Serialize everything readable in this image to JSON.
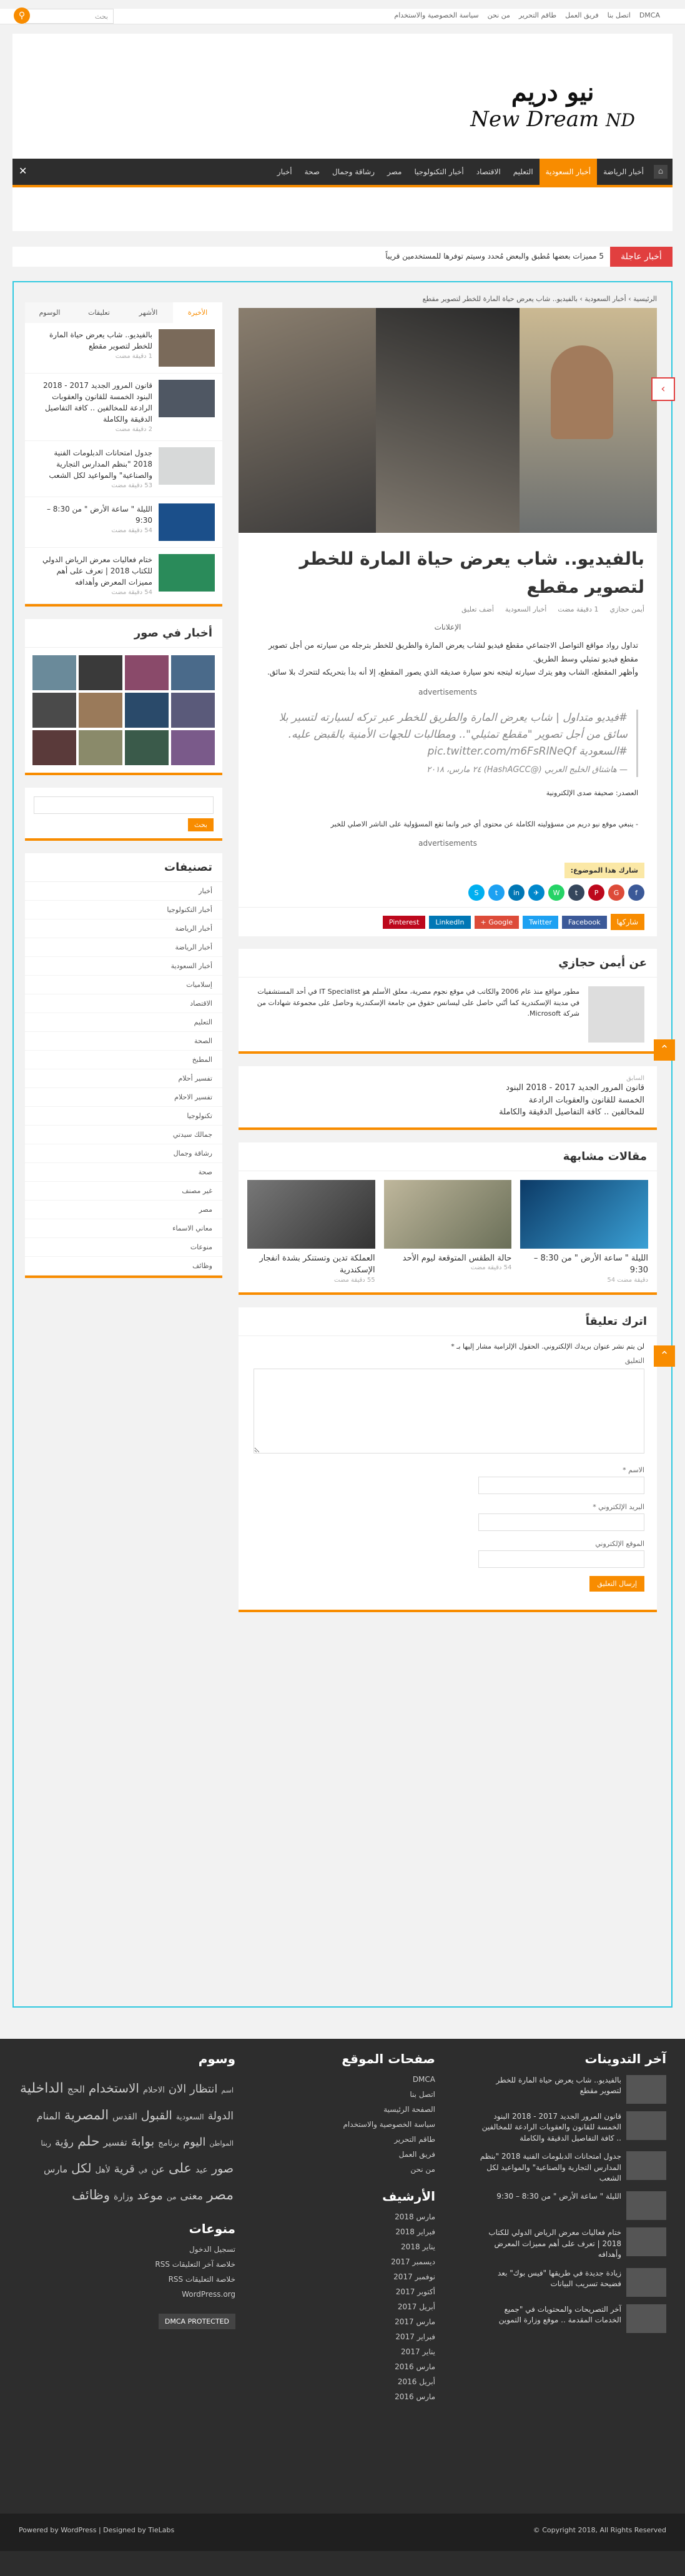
{
  "topbar": {
    "links": [
      "DMCA",
      "اتصل بنا",
      "فريق العمل",
      "طاقم التحرير",
      "من نحن",
      "سياسة الخصوصية والاستخدام"
    ],
    "search_placeholder": "بحث"
  },
  "logo": {
    "arabic": "نيو دريم",
    "english": "New Dream",
    "mark": "ND"
  },
  "nav": {
    "items": [
      "أخبار الرياضة",
      "أخبار السعودية",
      "التعليم",
      "الاقتصاد",
      "أخبار التكنولوجيا",
      "مصر",
      "رشاقة وجمال",
      "صحة",
      "أخبار"
    ]
  },
  "breaking": {
    "label": "أخبار عاجلة",
    "text": "5 مميزات بعضها مُطبق والبعض مُحدد وسيتم توفرها للمستخدمين قريباً"
  },
  "breadcrumb": [
    "الرئيسية",
    "أخبار السعودية",
    "بالفيديو.. شاب يعرض حياة المارة للخطر لتصوير مقطع"
  ],
  "post": {
    "title": "بالفيديو.. شاب يعرض حياة المارة للخطر لتصوير مقطع",
    "meta": {
      "author": "أيمن حجازي",
      "time": "1 دقيقة مضت",
      "category": "أخبار السعودية",
      "comments": "أضف تعليق"
    },
    "ad_label": "الإعلانات",
    "body": "تداول رواد مواقع التواصل الاجتماعي مقطع فيديو لشاب يعرض المارة والطريق للخطر بترجله من سيارته من أجل تصوير مقطع فيديو تمثيلي وسط الطريق.",
    "body2": "وأظهر المقطع، الشاب وهو يترك سيارته ليتجه نحو سيارة صديقه الذي يصور المقطع، إلا أنه بدأ بتحريكه لتتحرك بلا سائق.",
    "tweet": "#فيديو متداول | شاب يعرض المارة والطريق للخطر عبر تركه لسيارته لتسير بلا سائق من أجل تصوير \"مقطع تمثيلي\".. ومطالبات للجهات الأمنية بالقبض عليه. #السعودية pic.twitter.com/m6FsRlNeQf",
    "tweet_author": "— هاشتاق الخليج العربي (@HashAGCC) ٢٤ مارس، ٢٠١٨",
    "source": "العصدر: صحيفة صدى الإلكترونية",
    "disclaimer": "- ينبغي موقع نيو دريم من مسؤوليته الكاملة عن محتوى أي خبر وانما تقع المسؤولية على الناشر الاصلي للخبر",
    "advertisements": "advertisements",
    "share_label": "شارك هذا الموضوع:",
    "share_buttons": [
      "Facebook",
      "Twitter",
      "Google +",
      "LinkedIn",
      "Pinterest"
    ],
    "share_title": "شاركها"
  },
  "author_box": {
    "title": "عن أيمن حجازي",
    "bio": "مطور مواقع منذ عام 2006 والكاتب في موقع نجوم مصرية، معلق الأسلم هو IT Specialist في أحد المستشفيات في مدينة الإسكندرية كما أنّني حاصل على ليسانس حقوق من جامعة الإسكندرية وحاصل على مجموعة شهادات من شركة Microsoft."
  },
  "prev_post": {
    "label": "السابق",
    "title": "قانون المرور الجديد 2017 - 2018 البنود الخمسة للقانون والعقوبات الرادعة للمخالفين .. كافة التفاصيل الدقيقة والكاملة"
  },
  "related": {
    "title": "مقالات مشابهة",
    "items": [
      {
        "title": "الليلة \" ساعة الأرض \" من 8:30 – 9:30",
        "time": "دقيقة مضت 54"
      },
      {
        "title": "حالة الطقس المتوقعة ليوم الأحد",
        "time": "54 دقيقة مضت"
      },
      {
        "title": "العملكة تدين وتستنكر بشدة انفجار الإسكندرية",
        "time": "55 دقيقة مضت"
      }
    ]
  },
  "comment_form": {
    "title": "اترك تعليقاً",
    "note": "لن يتم نشر عنوان بريدك الإلكتروني. الحقول الإلزامية مشار إليها بـ *",
    "label_comment": "التعليق",
    "label_name": "الاسم *",
    "label_email": "البريد الإلكتروني *",
    "label_site": "الموقع الإلكتروني",
    "submit": "إرسال التعليق"
  },
  "sidebar": {
    "tabs": [
      "الأخيرة",
      "الأشهر",
      "تعليقات",
      "الوسوم"
    ],
    "recent": [
      {
        "title": "بالفيديو.. شاب يعرض حياة المارة للخطر لتصوير مقطع",
        "time": "1 دقيقة مضت"
      },
      {
        "title": "قانون المرور الجديد 2017 - 2018 البنود الخمسة للقانون والعقوبات الرادعة للمخالفين .. كافة التفاصيل الدقيقة والكاملة",
        "time": "2 دقيقة مضت"
      },
      {
        "title": "جدول امتحانات الدبلومات الفنية 2018 \"بنظم المدارس التجارية والصناعية\" والمواعيد لكل الشعب",
        "time": "53 دقيقة مضت"
      },
      {
        "title": "الليلة \" ساعة الأرض \" من 8:30 – 9:30",
        "time": "54 دقيقة مضت"
      },
      {
        "title": "ختام فعاليات معرض الرياض الدولي للكتاب 2018 | تعرف على أهم مميزات المعرض وأهدافه",
        "time": "54 دقيقة مضت"
      }
    ],
    "gallery_title": "أخبار في صور",
    "search_placeholder": "",
    "search_button": "بحث",
    "categories_title": "تصنيفات",
    "categories": [
      "أخبار",
      "أخبار التكنولوجيا",
      "أخبار الرياضة",
      "أخبار الرياضة",
      "أخبار السعودية",
      "إسلاميات",
      "الاقتصاد",
      "التعليم",
      "الصحة",
      "المطبخ",
      "تفسير أحلام",
      "تفسير الاحلام",
      "تكنولوجيا",
      "جمالك سيدتي",
      "رشاقة وجمال",
      "صحة",
      "غير مصنف",
      "مصر",
      "معاني الاسماء",
      "منوعات",
      "وظائف"
    ]
  },
  "footer": {
    "latest_title": "آخر التدوينات",
    "latest": [
      "بالفيديو.. شاب يعرض حياة المارة للخطر لتصوير مقطع",
      "قانون المرور الجديد 2017 - 2018 البنود الخمسة للقانون والعقوبات الرادعة للمخالفين .. كافة التفاصيل الدقيقة والكاملة",
      "جدول امتحانات الدبلومات الفنية 2018 \"بنظم المدارس التجارية والصناعية\" والمواعيد لكل الشعب",
      "الليلة \" ساعة الأرض \" من 8:30 – 9:30",
      "ختام فعاليات معرض الرياض الدولي للكتاب 2018 | تعرف على أهم مميزات المعرض وأهدافه",
      "زيادة جديدة في طريقها \"فيس بوك\" بعد فضيحة تسريب البيانات",
      "آخر التصريحات والمحتويات في \"جميع الخدمات المقدمة .. موقع وزارة التموين"
    ],
    "pages_title": "صفحات الموقع",
    "pages": [
      "DMCA",
      "اتصل بنا",
      "الصفحة الرئيسية",
      "سياسة الخصوصية والاستخدام",
      "طاقم التحرير",
      "فريق العمل",
      "من نحن"
    ],
    "archive_title": "الأرشيف",
    "archive": [
      "مارس 2018",
      "فبراير 2018",
      "يناير 2018",
      "ديسمبر 2017",
      "نوفمبر 2017",
      "أكتوبر 2017",
      "أبريل 2017",
      "مارس 2017",
      "فبراير 2017",
      "يناير 2017",
      "مارس 2016",
      "أبريل 2016",
      "مارس 2016"
    ],
    "tags_title": "وسوم",
    "tags": [
      "اسم",
      "انتظار الان",
      "الاحلام",
      "الاستخدام",
      "الحج",
      "الداخلية",
      "الدولة",
      "السعودية",
      "القبول",
      "القدس",
      "المصرية",
      "المنام",
      "المواطن",
      "اليوم",
      "برنامج",
      "بوابة",
      "تفسير",
      "حلم",
      "رؤية",
      "ربنا",
      "صور",
      "عيد",
      "على",
      "عن",
      "في",
      "قرية",
      "لأهل",
      "لكل",
      "مارس",
      "مصر",
      "معنى",
      "من",
      "موعد",
      "وزارة",
      "وظائف"
    ],
    "misc_title": "منوعات",
    "misc": [
      "تسجيل الدخول",
      "خلاصة آخر التعليقات RSS",
      "خلاصة التعليقات RSS",
      "WordPress.org"
    ],
    "copyright": "Copyright 2018, All Rights Reserved ©",
    "powered": "Powered by WordPress | Designed by TieLabs",
    "dmca": "DMCA PROTECTED"
  },
  "colors": {
    "accent": "#f88c00",
    "breaking": "#e13f3f",
    "frame": "#30c9e0",
    "nav": "#2d2d2d"
  }
}
